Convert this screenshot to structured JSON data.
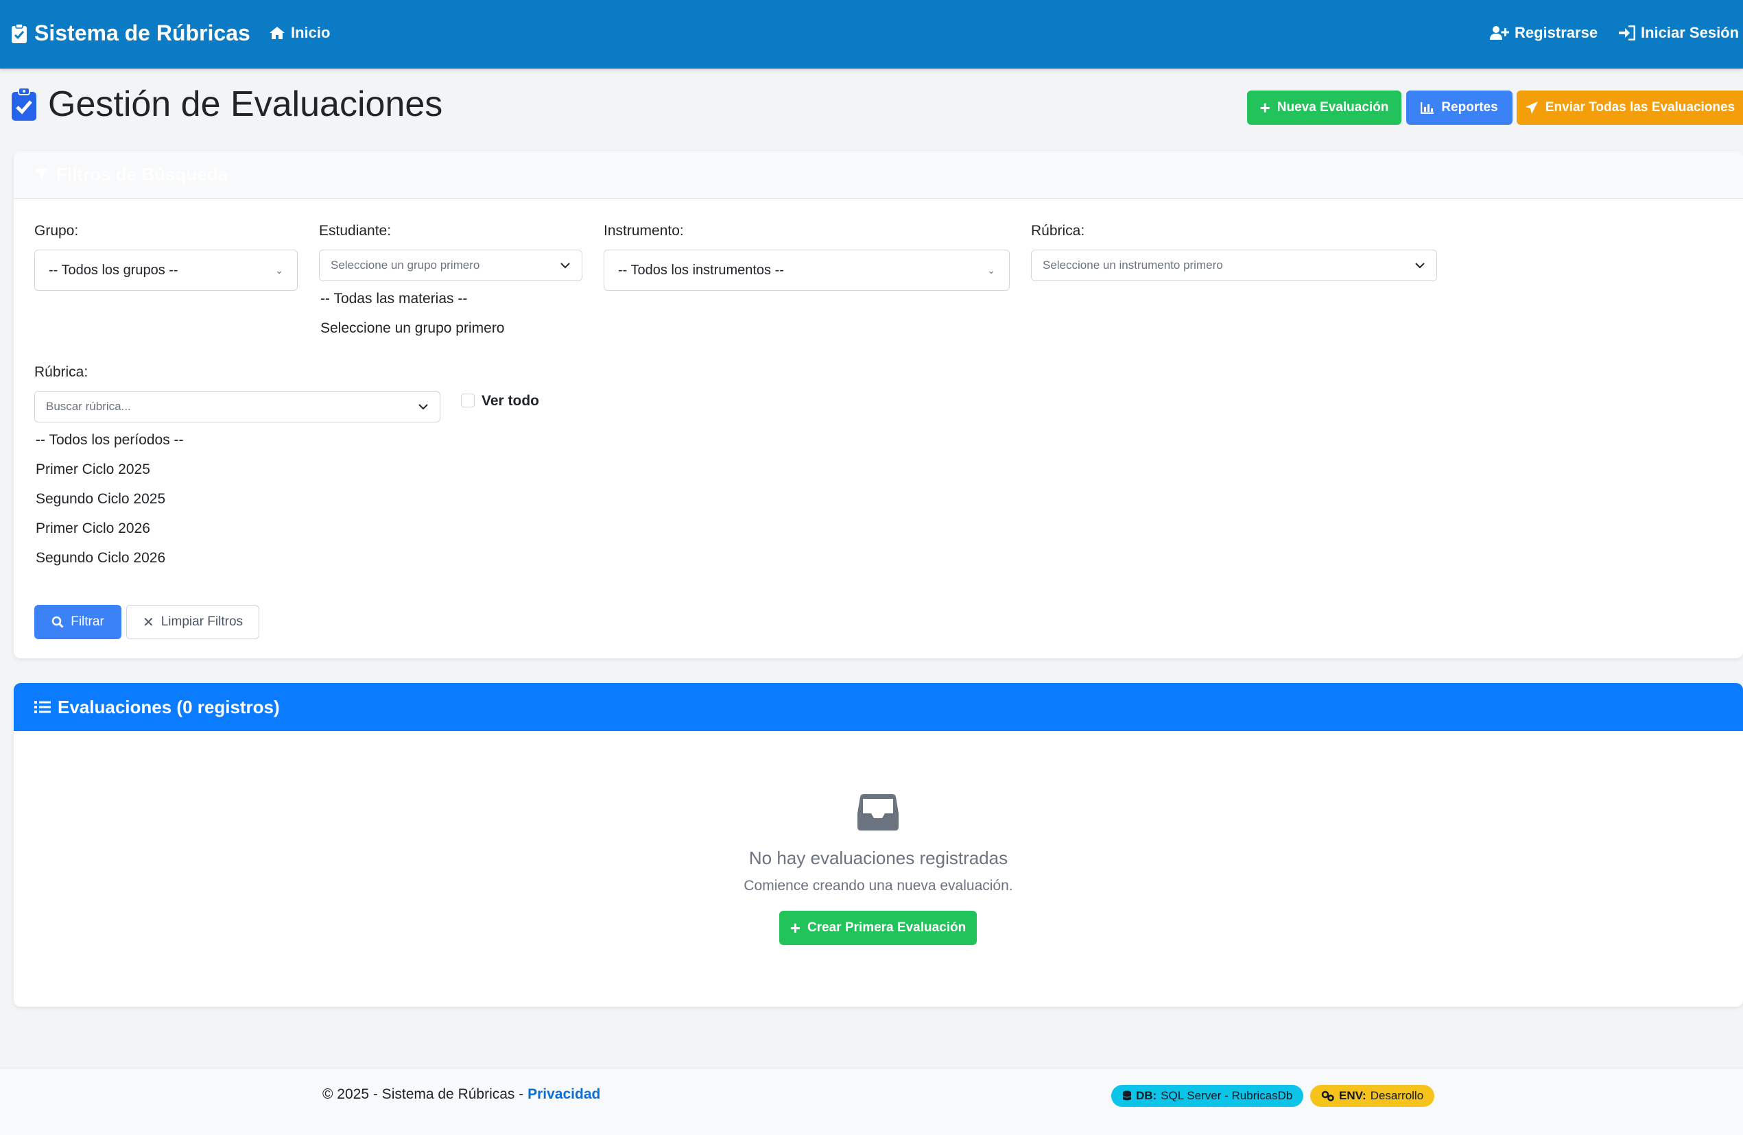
{
  "navbar": {
    "brand": "Sistema de Rúbricas",
    "home": "Inicio",
    "register": "Registrarse",
    "login": "Iniciar Sesión"
  },
  "page": {
    "title": "Gestión de Evaluaciones",
    "buttons": {
      "new": "Nueva Evaluación",
      "reports": "Reportes",
      "send_all": "Enviar Todas las Evaluaciones"
    }
  },
  "filters": {
    "header": "Filtros de Búsqueda",
    "grupo": {
      "label": "Grupo:",
      "value": "-- Todos los grupos --"
    },
    "estudiante": {
      "label": "Estudiante:",
      "value": "Seleccione un grupo primero"
    },
    "materias": [
      "-- Todas las materias --",
      "Seleccione un grupo primero"
    ],
    "instrumento": {
      "label": "Instrumento:",
      "value": "-- Todos los instrumentos --"
    },
    "rubrica_top": {
      "label": "Rúbrica:",
      "value": "Seleccione un instrumento primero"
    },
    "rubrica_search": {
      "label": "Rúbrica:",
      "placeholder": "Buscar rúbrica..."
    },
    "ver_todo": "Ver todo",
    "periodos": [
      "-- Todos los períodos --",
      "Primer Ciclo 2025",
      "Segundo Ciclo 2025",
      "Primer Ciclo 2026",
      "Segundo Ciclo 2026"
    ],
    "filter_button": "Filtrar",
    "clear_button": "Limpiar Filtros"
  },
  "evaluations": {
    "header": "Evaluaciones (0 registros)",
    "empty_title": "No hay evaluaciones registradas",
    "empty_subtitle": "Comience creando una nueva evaluación.",
    "create_button": "Crear Primera Evaluación"
  },
  "footer": {
    "copyright": "© 2025 - Sistema de Rúbricas - ",
    "privacy": "Privacidad",
    "db_label": "DB:",
    "db_value": "SQL Server - RubricasDb",
    "env_label": "ENV:",
    "env_value": "Desarrollo"
  },
  "colors": {
    "navbar": "#0a7bc4",
    "primary": "#3b82f6",
    "success": "#22c35b",
    "warning": "#f59e0b",
    "eval_header": "#0b7bff"
  }
}
